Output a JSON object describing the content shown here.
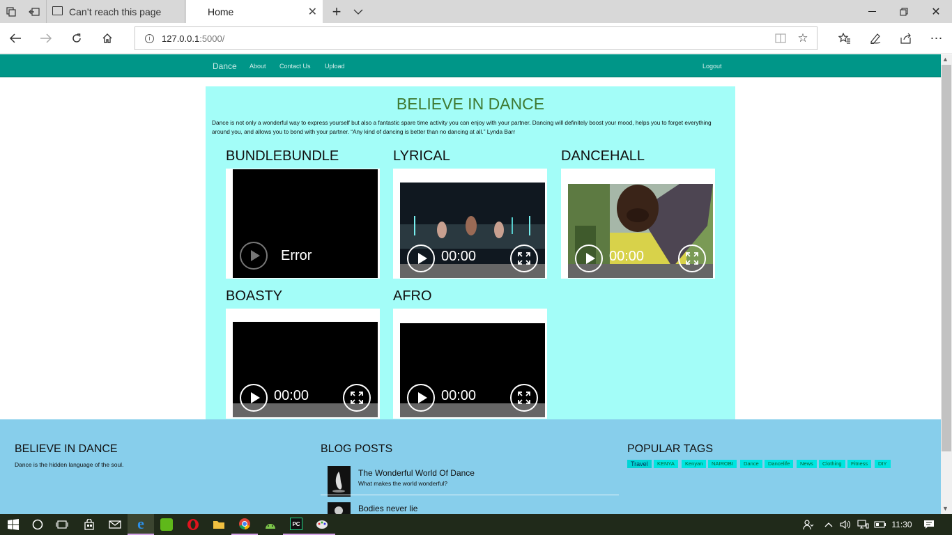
{
  "browser": {
    "tabs": [
      {
        "title": "Can’t reach this page"
      },
      {
        "title": "Home"
      }
    ],
    "address": {
      "host": "127.0.0.1",
      "port_path": ":5000/"
    }
  },
  "nav": {
    "brand": "Dance",
    "links": [
      "About",
      "Contact Us",
      "Upload"
    ],
    "logout": "Logout"
  },
  "main": {
    "title": "BELIEVE IN DANCE",
    "intro": "Dance is not only a wonderful way to express yourself but also a fantastic spare time activity you can enjoy with your partner. Dancing will definitely boost your mood, helps you to forget everything around you, and allows you to bond with your partner. “Any kind of dancing is better than no dancing at all.” Lynda Barr",
    "videos": [
      {
        "label": "BUNDLEBUNDLE",
        "status": "Error"
      },
      {
        "label": "LYRICAL",
        "time": "00:00"
      },
      {
        "label": "DANCEHALL",
        "time": "00:00"
      },
      {
        "label": "BOASTY",
        "time": "00:00"
      },
      {
        "label": "AFRO",
        "time": "00:00"
      }
    ]
  },
  "footer": {
    "about": {
      "title": "BELIEVE IN DANCE",
      "text": "Dance is the hidden language of the soul."
    },
    "blog": {
      "title": "BLOG POSTS",
      "posts": [
        {
          "title": "The Wonderful World Of Dance",
          "subtitle": "What makes the world wonderful?"
        },
        {
          "title": "Bodies never lie"
        }
      ]
    },
    "tags": {
      "title": "POPULAR TAGS",
      "items": [
        "Travel",
        "KENYA",
        "Kenyan",
        "NAIROBI",
        "Dance",
        "Dancelife",
        "News",
        "Clothing",
        "Fitness",
        "DIY"
      ]
    }
  },
  "taskbar": {
    "time": "11:30"
  }
}
